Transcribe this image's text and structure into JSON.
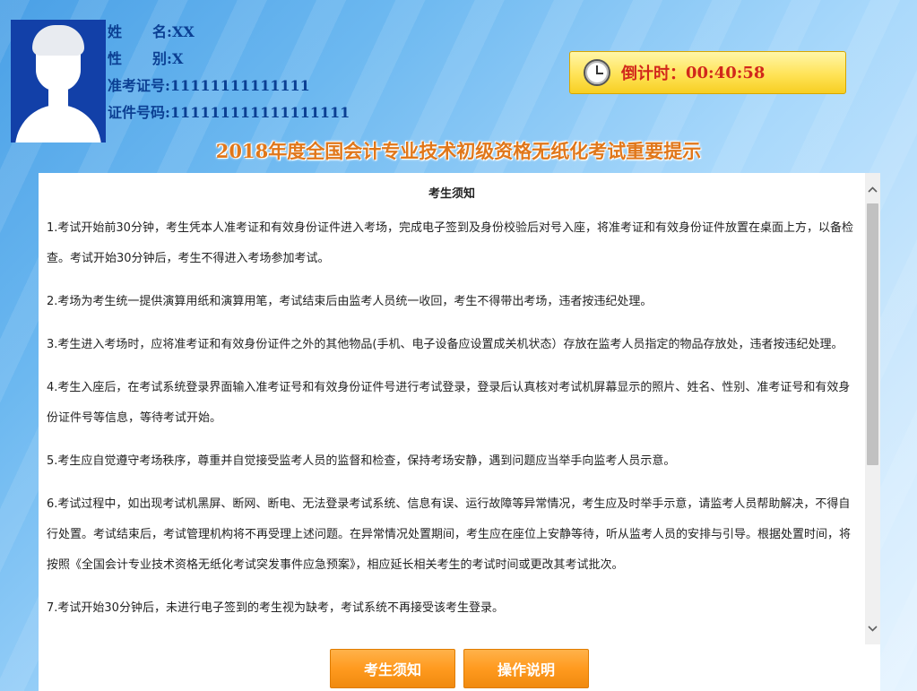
{
  "candidate": {
    "name_label": "姓名:",
    "name_value": "XX",
    "gender_label": "性别:",
    "gender_value": "X",
    "ticket_label": "准考证号:",
    "ticket_value": "11111111111111",
    "id_label": "证件号码:",
    "id_value": "111111111111111111"
  },
  "timer": {
    "label": "倒计时：",
    "value": "00:40:58"
  },
  "title": "2018年度全国会计专业技术初级资格无纸化考试重要提示",
  "notice": {
    "heading": "考生须知",
    "items": [
      "1.考试开始前30分钟，考生凭本人准考证和有效身份证件进入考场，完成电子签到及身份校验后对号入座，将准考证和有效身份证件放置在桌面上方，以备检查。考试开始30分钟后，考生不得进入考场参加考试。",
      "2.考场为考生统一提供演算用纸和演算用笔，考试结束后由监考人员统一收回，考生不得带出考场，违者按违纪处理。",
      "3.考生进入考场时，应将准考证和有效身份证件之外的其他物品(手机、电子设备应设置成关机状态）存放在监考人员指定的物品存放处，违者按违纪处理。",
      "4.考生入座后，在考试系统登录界面输入准考证号和有效身份证件号进行考试登录，登录后认真核对考试机屏幕显示的照片、姓名、性别、准考证号和有效身份证件号等信息，等待考试开始。",
      "5.考生应自觉遵守考场秩序，尊重并自觉接受监考人员的监督和检查，保持考场安静，遇到问题应当举手向监考人员示意。",
      "6.考试过程中，如出现考试机黑屏、断网、断电、无法登录考试系统、信息有误、运行故障等异常情况，考生应及时举手示意，请监考人员帮助解决，不得自行处置。考试结束后，考试管理机构将不再受理上述问题。在异常情况处置期间，考生应在座位上安静等待，听从监考人员的安排与引导。根据处置时间，将按照《全国会计专业技术资格无纸化考试突发事件应急预案》，相应延长相关考生的考试时间或更改其考试批次。",
      "7.考试开始30分钟后，未进行电子签到的考生视为缺考，考试系统不再接受该考生登录。"
    ]
  },
  "buttons": {
    "notice": "考生须知",
    "guide": "操作说明"
  },
  "icons": {
    "clock": "clock-icon",
    "scroll_up": "chevron-up-icon",
    "scroll_down": "chevron-down-icon"
  }
}
